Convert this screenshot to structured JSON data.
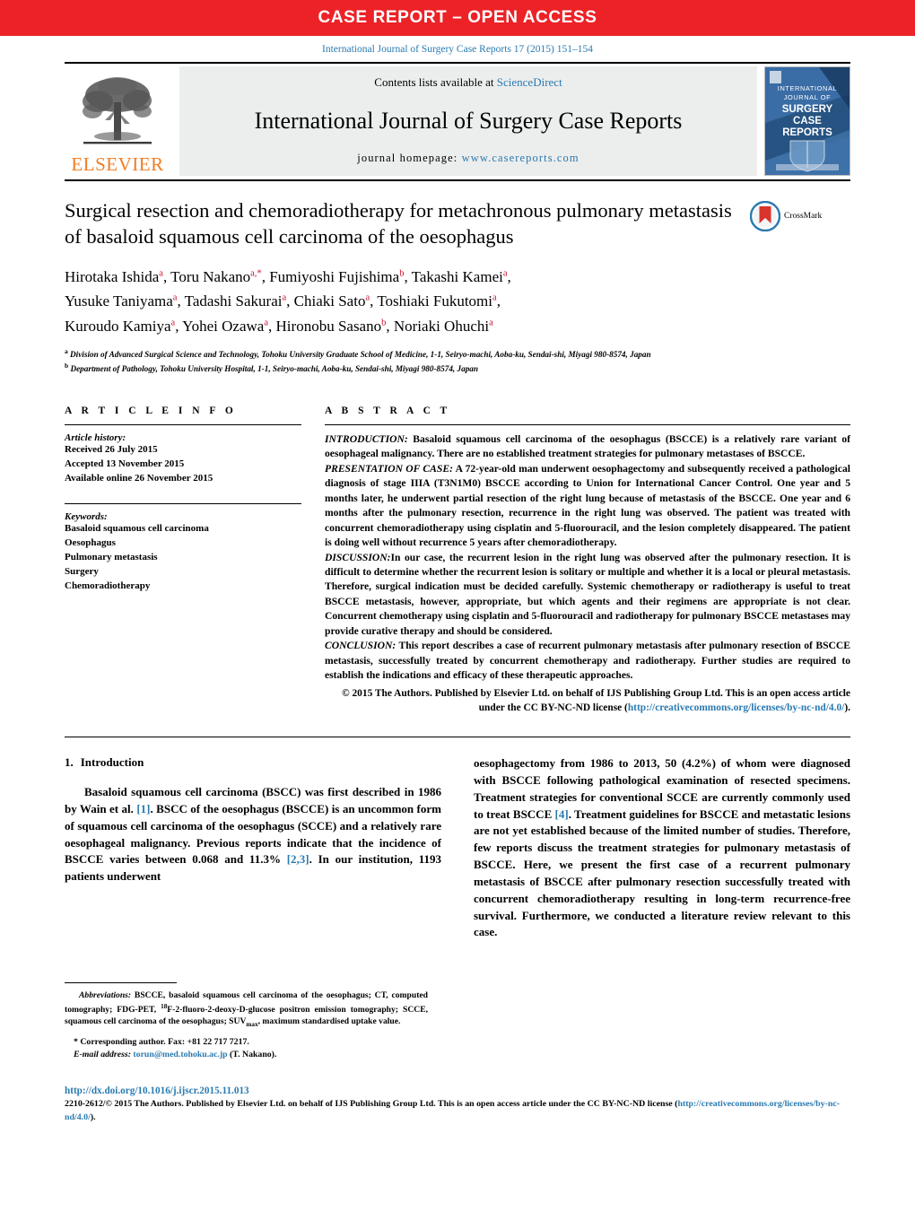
{
  "banner": {
    "text": "CASE REPORT – OPEN ACCESS"
  },
  "citation": "International Journal of Surgery Case Reports 17 (2015) 151–154",
  "masthead": {
    "publisher": "ELSEVIER",
    "contents_prefix": "Contents lists available at ",
    "contents_link": "ScienceDirect",
    "journal_name": "International Journal of Surgery Case Reports",
    "homepage_label": "journal homepage: ",
    "homepage_url": "www.casereports.com",
    "cover": {
      "line1": "INTERNATIONAL",
      "line2": "JOURNAL OF",
      "line3": "SURGERY",
      "line4": "CASE",
      "line5": "REPORTS"
    }
  },
  "article": {
    "title": "Surgical resection and chemoradiotherapy for metachronous pulmonary metastasis of basaloid squamous cell carcinoma of the oesophagus",
    "crossmark_label": "CrossMark",
    "authors": [
      {
        "name": "Hirotaka Ishida",
        "marks": "a"
      },
      {
        "name": "Toru Nakano",
        "marks": "a,*"
      },
      {
        "name": "Fumiyoshi Fujishima",
        "marks": "b"
      },
      {
        "name": "Takashi Kamei",
        "marks": "a"
      },
      {
        "name": "Yusuke Taniyama",
        "marks": "a"
      },
      {
        "name": "Tadashi Sakurai",
        "marks": "a"
      },
      {
        "name": "Chiaki Sato",
        "marks": "a"
      },
      {
        "name": "Toshiaki Fukutomi",
        "marks": "a"
      },
      {
        "name": "Kuroudo Kamiya",
        "marks": "a"
      },
      {
        "name": "Yohei Ozawa",
        "marks": "a"
      },
      {
        "name": "Hironobu Sasano",
        "marks": "b"
      },
      {
        "name": "Noriaki Ohuchi",
        "marks": "a"
      }
    ],
    "affiliations": [
      {
        "mark": "a",
        "text": "Division of Advanced Surgical Science and Technology, Tohoku University Graduate School of Medicine, 1-1, Seiryo-machi, Aoba-ku, Sendai-shi, Miyagi 980-8574, Japan"
      },
      {
        "mark": "b",
        "text": "Department of Pathology, Tohoku University Hospital, 1-1, Seiryo-machi, Aoba-ku, Sendai-shi, Miyagi 980-8574, Japan"
      }
    ]
  },
  "article_info": {
    "heading": "A R T I C L E    I N F O",
    "history_label": "Article history:",
    "history": [
      "Received 26 July 2015",
      "Accepted 13 November 2015",
      "Available online 26 November 2015"
    ],
    "keywords_label": "Keywords:",
    "keywords": [
      "Basaloid squamous cell carcinoma",
      "Oesophagus",
      "Pulmonary metastasis",
      "Surgery",
      "Chemoradiotherapy"
    ]
  },
  "abstract": {
    "heading": "A B S T R A C T",
    "sections": [
      {
        "label": "INTRODUCTION:",
        "body": " Basaloid squamous cell carcinoma of the oesophagus (BSCCE) is a relatively rare variant of oesophageal malignancy. There are no established treatment strategies for pulmonary metastases of BSCCE."
      },
      {
        "label": "PRESENTATION OF CASE:",
        "body": " A 72-year-old man underwent oesophagectomy and subsequently received a pathological diagnosis of stage IIIA (T3N1M0) BSCCE according to Union for International Cancer Control. One year and 5 months later, he underwent partial resection of the right lung because of metastasis of the BSCCE. One year and 6 months after the pulmonary resection, recurrence in the right lung was observed. The patient was treated with concurrent chemoradiotherapy using cisplatin and 5-fluorouracil, and the lesion completely disappeared. The patient is doing well without recurrence 5 years after chemoradiotherapy."
      },
      {
        "label": "DISCUSSION:",
        "body": "In our case, the recurrent lesion in the right lung was observed after the pulmonary resection. It is difficult to determine whether the recurrent lesion is solitary or multiple and whether it is a local or pleural metastasis. Therefore, surgical indication must be decided carefully. Systemic chemotherapy or radiotherapy is useful to treat BSCCE metastasis, however, appropriate, but which agents and their regimens are appropriate is not clear. Concurrent chemotherapy using cisplatin and 5-fluorouracil and radiotherapy for pulmonary BSCCE metastases may provide curative therapy and should be considered."
      },
      {
        "label": "CONCLUSION:",
        "body": " This report describes a case of recurrent pulmonary metastasis after pulmonary resection of BSCCE metastasis, successfully treated by concurrent chemotherapy and radiotherapy. Further studies are required to establish the indications and efficacy of these therapeutic approaches."
      }
    ],
    "copyright_text": "© 2015 The Authors. Published by Elsevier Ltd. on behalf of IJS Publishing Group Ltd. This is an open access article under the CC BY-NC-ND license (",
    "copyright_link": "http://creativecommons.org/licenses/by-nc-nd/4.0/",
    "copyright_tail": ")."
  },
  "introduction": {
    "number": "1.",
    "title": "Introduction",
    "left_part_1": "Basaloid squamous cell carcinoma (BSCC) was first described in 1986 by Wain et al. ",
    "ref_1": "[1]",
    "left_part_2": ". BSCC of the oesophagus (BSCCE) is an uncommon form of squamous cell carcinoma of the oesophagus (SCCE) and a relatively rare oesophageal malignancy. Previous reports indicate that the incidence of BSCCE varies between 0.068 and 11.3% ",
    "ref_2": "[2,3]",
    "left_part_3": ". In our institution, 1193 patients underwent",
    "right_part_1": "oesophagectomy from 1986 to 2013, 50 (4.2%) of whom were diagnosed with BSCCE following pathological examination of resected specimens. Treatment strategies for conventional SCCE are currently commonly used to treat BSCCE ",
    "ref_3": "[4]",
    "right_part_2": ". Treatment guidelines for BSCCE and metastatic lesions are not yet established because of the limited number of studies. Therefore, few reports discuss the treatment strategies for pulmonary metastasis of BSCCE. Here, we present the first case of a recurrent pulmonary metastasis of BSCCE after pulmonary resection successfully treated with concurrent chemoradiotherapy resulting in long-term recurrence-free survival. Furthermore, we conducted a literature review relevant to this case."
  },
  "footnotes": {
    "abbrev_label": "Abbreviations:",
    "abbrev_part1": " BSCCE, basaloid squamous cell carcinoma of the oesophagus; CT, computed tomography; FDG-PET, ",
    "abbrev_sup": "18",
    "abbrev_part2": "F-2-fluoro-2-deoxy-",
    "abbrev_part3": "D",
    "abbrev_part4": "-glucose positron emission tomography; SCCE, squamous cell carcinoma of the oesophagus; SUV",
    "abbrev_sub": "max",
    "abbrev_part5": ", maximum standardised uptake value.",
    "corresponding": "* Corresponding author. Fax: +81 22 717 7217.",
    "email_label": "E-mail address:",
    "email": "torun@med.tohoku.ac.jp",
    "email_tail": " (T. Nakano)."
  },
  "bottom": {
    "doi": "http://dx.doi.org/10.1016/j.ijscr.2015.11.013",
    "issn_text": "2210-2612/© 2015 The Authors. Published by Elsevier Ltd. on behalf of IJS Publishing Group Ltd. This is an open access article under the CC BY-NC-ND license (",
    "issn_link": "http://creativecommons.org/licenses/by-nc-nd/4.0/",
    "issn_tail": ")."
  },
  "colors": {
    "banner_red": "#ec2227",
    "link_blue": "#2a7ab0",
    "elsevier_orange": "#f07d23",
    "affiliation_red": "#c8102e"
  }
}
